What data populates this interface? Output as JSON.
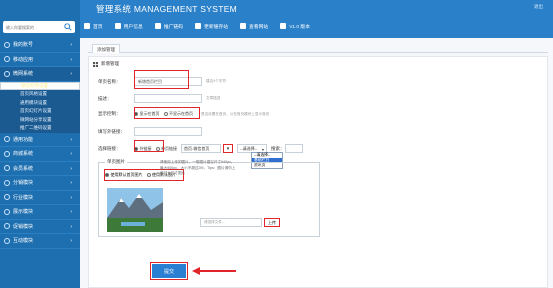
{
  "app": {
    "title": "管理系统 MANAGEMENT SYSTEM",
    "top_link": "退出"
  },
  "search": {
    "placeholder": "输入你要搜索的"
  },
  "topnav": [
    {
      "label": "首页",
      "icon": "home-icon"
    },
    {
      "label": "用户信息",
      "icon": "user-icon"
    },
    {
      "label": "推广链码",
      "icon": "link-icon"
    },
    {
      "label": "更新缓存站",
      "icon": "refresh-icon"
    },
    {
      "label": "查看网站",
      "icon": "eye-icon"
    },
    {
      "label": "V1.0 版本",
      "icon": "info-icon"
    }
  ],
  "sidebar": {
    "items": [
      {
        "label": "我的账号"
      },
      {
        "label": "移动应用"
      },
      {
        "label": "微网系统"
      }
    ],
    "sub_items": [
      {
        "label": "微信栏目设置"
      },
      {
        "label": "首页风格设置"
      },
      {
        "label": "通用模块设置"
      },
      {
        "label": "首页幻灯片设置"
      },
      {
        "label": "微网站分享设置"
      },
      {
        "label": "推广二维码设置"
      }
    ],
    "items_after": [
      {
        "label": "通用功能"
      },
      {
        "label": "商城系统"
      },
      {
        "label": "会员系统"
      },
      {
        "label": "分销模块"
      },
      {
        "label": "行业模块"
      },
      {
        "label": "展示模块"
      },
      {
        "label": "促销模块"
      },
      {
        "label": "互动模块"
      }
    ]
  },
  "tab": {
    "label": "添加管理"
  },
  "panel": {
    "title": "新增管理"
  },
  "form": {
    "name_label": "单页名称：",
    "name_value": "新增首页栏目",
    "name_hint": "建议4个字符",
    "desc_label": "描述：",
    "desc_hint": "文章描述",
    "home_label": "显示控制：",
    "home_opt1": "显示在首页",
    "home_opt2": "不显示在首页",
    "home_hint": "是否设置在首页，以在首页模块上显示首页",
    "url_label": "填写外链接：",
    "link_label": "选择链接：",
    "link_opt1": "外链接",
    "link_opt2": "单页链接",
    "select1_value": "首页-微信首页",
    "select2_value": "--请选择--",
    "select3_label": "搜索：",
    "dropdown_options": [
      "--请选择--",
      "基础栏目",
      "资讯页"
    ]
  },
  "image_section": {
    "legend": "单页图片",
    "opt1": "使用默认首页图片",
    "opt2": "使用默认图片",
    "desc": "请使用上传的图片，一般图片建议尺寸640px，最大900px，大小不超过2M，Tips：图片请勿上传过大尺寸图片",
    "file_placeholder": "请选择文件...",
    "upload_label": "上传"
  },
  "submit_label": "提交",
  "colors": {
    "accent": "#2b7fd2",
    "sidebar": "#1e6fb0",
    "highlight": "#e0262b"
  }
}
